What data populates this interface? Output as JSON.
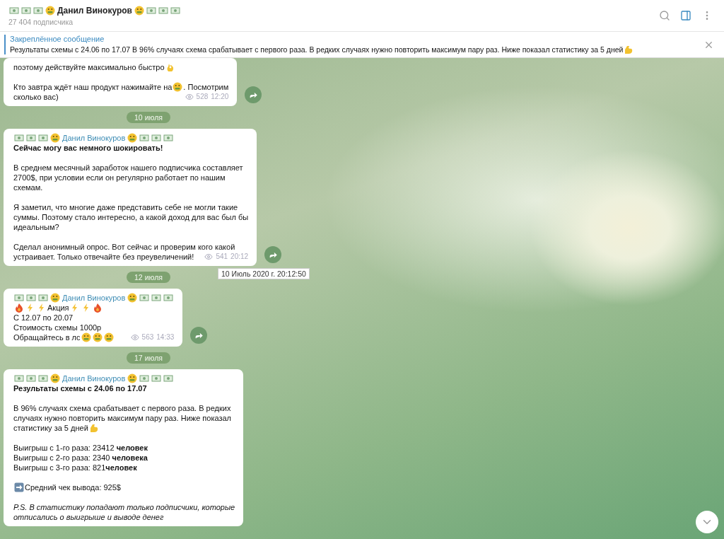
{
  "header": {
    "title": "Данил Винокуров",
    "subtitle": "27 404 подписчика"
  },
  "pinned": {
    "label": "Закреплённое сообщение",
    "content": [
      {
        "kind": "text",
        "text": "Результаты схемы с 24.06  по 17.07   В 96% случаях схема срабатывает с первого раза. В редких случаях нужно повторить максимум пару раз. Ниже показал статистику за 5 дней"
      },
      {
        "kind": "muscle"
      }
    ]
  },
  "feed": [
    {
      "kind": "message",
      "paragraphs": [
        [
          [
            {
              "kind": "text",
              "text": "поэтому действуйте максимально быстро"
            },
            {
              "kind": "ok-hand"
            }
          ]
        ],
        [
          [
            {
              "kind": "text",
              "text": "Кто завтра ждёт наш продукт нажимайте на "
            },
            {
              "kind": "money-face"
            },
            {
              "kind": "text",
              "text": ". Посмотрим"
            }
          ],
          [
            {
              "kind": "text",
              "text": "сколько вас)"
            }
          ]
        ]
      ],
      "views": "528",
      "time": "12:20"
    },
    {
      "kind": "date",
      "text": "10 июля"
    },
    {
      "kind": "message",
      "author": "Данил Винокуров",
      "paragraphs": [
        [
          [
            {
              "kind": "bold",
              "text": "Сейчас могу вас немного шокировать!"
            }
          ]
        ],
        [
          [
            {
              "kind": "text",
              "text": "В среднем месячный заработок нашего подписчика составляет"
            }
          ],
          [
            {
              "kind": "text",
              "text": "2700$, при условии если он регулярно работает по нашим"
            }
          ],
          [
            {
              "kind": "text",
              "text": "схемам."
            }
          ]
        ],
        [
          [
            {
              "kind": "text",
              "text": "Я заметил, что многие даже представить себе не могли такие"
            }
          ],
          [
            {
              "kind": "text",
              "text": "суммы. Поэтому стало интересно, а какой доход для вас был бы"
            }
          ],
          [
            {
              "kind": "text",
              "text": "идеальным?"
            }
          ]
        ],
        [
          [
            {
              "kind": "text",
              "text": "Сделал анонимный опрос. Вот сейчас и проверим кого какой"
            }
          ],
          [
            {
              "kind": "text",
              "text": "устраивает. Только отвечайте без преувеличений!"
            }
          ]
        ]
      ],
      "views": "541",
      "time": "20:12",
      "tooltip": "10 Июль 2020 г. 20:12:50"
    },
    {
      "kind": "date",
      "text": "12 июля"
    },
    {
      "kind": "message",
      "author": "Данил Винокуров",
      "paragraphs": [
        [
          [
            {
              "kind": "fire"
            },
            {
              "kind": "zap"
            },
            {
              "kind": "zap"
            },
            {
              "kind": "text",
              "text": "Акция"
            },
            {
              "kind": "zap"
            },
            {
              "kind": "zap"
            },
            {
              "kind": "fire"
            }
          ],
          [
            {
              "kind": "text",
              "text": "С 12.07 по 20.07"
            }
          ],
          [
            {
              "kind": "text",
              "text": "Стоимость схемы 1000р"
            }
          ],
          [
            {
              "kind": "text",
              "text": "Обращайтесь в лс "
            },
            {
              "kind": "money-face"
            },
            {
              "kind": "money-face"
            },
            {
              "kind": "money-face"
            }
          ]
        ]
      ],
      "views": "563",
      "time": "14:33"
    },
    {
      "kind": "date",
      "text": "17 июля"
    },
    {
      "kind": "message",
      "author": "Данил Винокуров",
      "paragraphs": [
        [
          [
            {
              "kind": "bold",
              "text": "Результаты схемы с 24.06  по 17.07"
            }
          ]
        ],
        [
          [
            {
              "kind": "text",
              "text": "В 96% случаях схема срабатывает с первого раза. В редких"
            }
          ],
          [
            {
              "kind": "text",
              "text": "случаях нужно повторить максимум пару раз. Ниже показал"
            }
          ],
          [
            {
              "kind": "text",
              "text": "статистику за 5 дней"
            },
            {
              "kind": "muscle"
            }
          ]
        ],
        [
          [
            {
              "kind": "text",
              "text": "Выигрыш с 1-го раза: 23412 "
            },
            {
              "kind": "bold",
              "text": "человек"
            }
          ],
          [
            {
              "kind": "text",
              "text": "Выигрыш с 2-го раза: 2340 "
            },
            {
              "kind": "bold",
              "text": "человека"
            }
          ],
          [
            {
              "kind": "text",
              "text": "Выигрыш с 3-го раза: 821"
            },
            {
              "kind": "bold",
              "text": "человек"
            }
          ]
        ],
        [
          [
            {
              "kind": "arrow-right"
            },
            {
              "kind": "text",
              "text": " Средний чек вывода: 925$"
            }
          ]
        ],
        [
          [
            {
              "kind": "italic",
              "text": "P.S. В статистику попадают только подписчики, которые"
            }
          ],
          [
            {
              "kind": "italic",
              "text": "отписались о выигрыше и выводе денег"
            }
          ]
        ]
      ]
    }
  ]
}
